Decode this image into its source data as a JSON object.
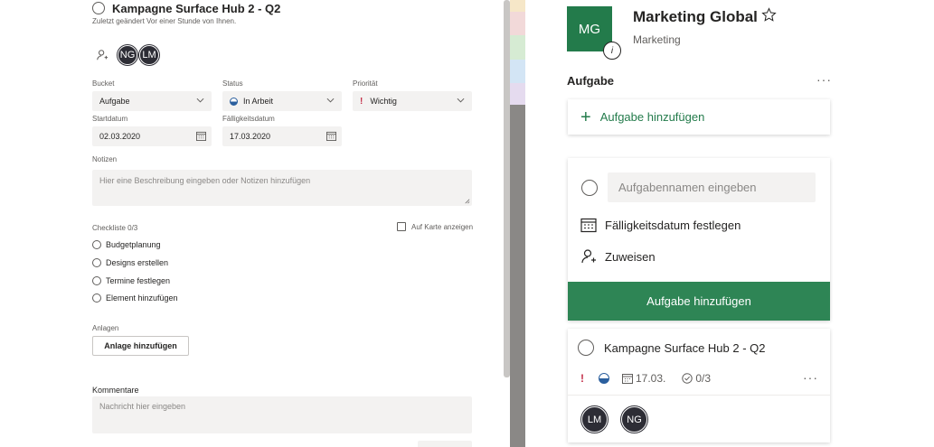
{
  "detail": {
    "title": "Kampagne Surface Hub 2 - Q2",
    "modified": "Zuletzt geändert Vor einer Stunde von Ihnen.",
    "assignees": [
      "NG",
      "LM"
    ],
    "bucket": {
      "label": "Bucket",
      "value": "Aufgabe"
    },
    "status": {
      "label": "Status",
      "value": "In Arbeit"
    },
    "priority": {
      "label": "Priorität",
      "value": "Wichtig",
      "icon": "!"
    },
    "start": {
      "label": "Startdatum",
      "value": "02.03.2020"
    },
    "due": {
      "label": "Fälligkeitsdatum",
      "value": "17.03.2020"
    },
    "notes": {
      "label": "Notizen",
      "placeholder": "Hier eine Beschreibung eingeben oder Notizen hinzufügen"
    },
    "checklist": {
      "label": "Checkliste 0/3",
      "show_on_card": "Auf Karte anzeigen",
      "items": [
        "Budgetplanung",
        "Designs erstellen",
        "Termine festlegen",
        "Element hinzufügen"
      ]
    },
    "attachments": {
      "label": "Anlagen",
      "button": "Anlage hinzufügen"
    },
    "comments": {
      "label": "Kommentare",
      "placeholder": "Nachricht hier eingeben"
    }
  },
  "group": {
    "initials": "MG",
    "info": "i",
    "name": "Marketing Global",
    "star": "☆",
    "subtitle": "Marketing",
    "color": "#237b4b"
  },
  "bucket": {
    "title": "Aufgabe",
    "more": "···",
    "add_task": {
      "plus": "+",
      "label": "Aufgabe hinzufügen"
    },
    "new_task": {
      "placeholder": "Aufgabennamen eingeben",
      "due_label": "Fälligkeitsdatum festlegen",
      "assign_label": "Zuweisen",
      "submit": "Aufgabe hinzufügen"
    },
    "card": {
      "title": "Kampagne Surface Hub 2 - Q2",
      "priority_icon": "!",
      "due": "17.03.",
      "checklist": "0/3",
      "more": "···",
      "assignees": [
        "LM",
        "NG"
      ]
    }
  },
  "colors": {
    "accent": "#237b4b",
    "button": "#2e8555",
    "priority": "#c4314b",
    "progress": "#2b5f9e"
  }
}
